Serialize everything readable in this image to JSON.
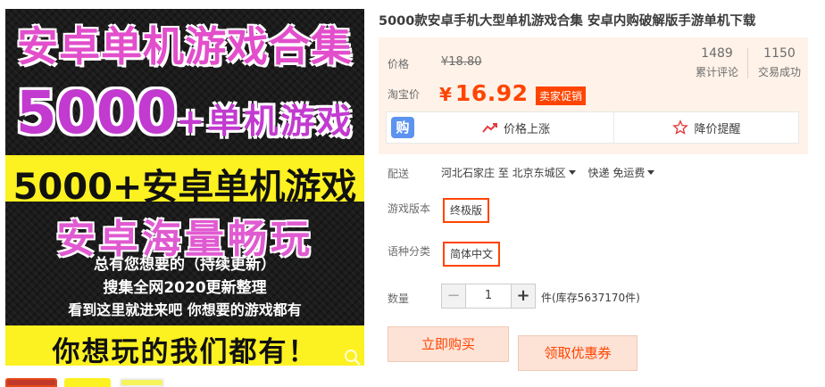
{
  "promo_image": {
    "title": "安卓单机游戏合集",
    "big_number": "5000",
    "big_suffix": "+单机游戏",
    "band": "5000+安卓单机游戏",
    "headline": "安卓海量畅玩",
    "line1": "总有您想要的（持续更新）",
    "line2": "搜集全网2020更新整理",
    "line3": "看到这里就进来吧 你想要的游戏都有",
    "footer": "你想玩的我们都有！",
    "zoom_icon": "magnifier-icon"
  },
  "product": {
    "title": "5000款安卓手机大型单机游戏合集 安卓内购破解版手游单机下载"
  },
  "price": {
    "label": "价格",
    "original": "¥18.80",
    "taobao_label": "淘宝价",
    "currency": "¥",
    "value": "16.92",
    "promo_tag": "卖家促销",
    "color": "#ff4400"
  },
  "stats": {
    "reviews": "1489",
    "reviews_label": "累计评论",
    "sales": "1150",
    "sales_label": "交易成功"
  },
  "alerts": {
    "gou_label": "购",
    "price_up": "价格上涨",
    "price_drop": "降价提醒"
  },
  "shipping": {
    "label": "配送",
    "from": "河北石家庄 至",
    "to": "北京东城区",
    "method": "快递 免运费"
  },
  "options": {
    "version_label": "游戏版本",
    "version_value": "终极版",
    "language_label": "语种分类",
    "language_value": "简体中文"
  },
  "quantity": {
    "label": "数量",
    "minus": "−",
    "value": "1",
    "plus": "+",
    "stock": "件(库存5637170件)"
  },
  "actions": {
    "buy_now": "立即购买",
    "get_coupon": "领取优惠券"
  }
}
